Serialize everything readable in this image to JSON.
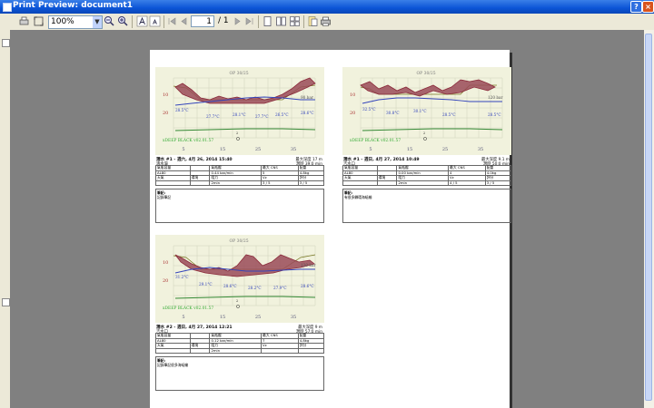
{
  "window": {
    "title": "Print Preview: document1"
  },
  "toolbar": {
    "zoom_value": "100%",
    "page_current": "1",
    "page_total": "/ 1"
  },
  "page_title": "OP 30/25",
  "plot_labels": {
    "depth10": "10",
    "depth20": "20",
    "x5": "5",
    "x15": "15",
    "x25": "25",
    "x35": "35",
    "device": "xDEEP BLACK v02.01.57"
  },
  "dives": [
    {
      "datetime": "潛水 #1 - 週六, 4月 26, 2014 15:40",
      "location": "清水灣",
      "max_depth": "最大深度 17 m",
      "duration": "潛時 39:0 min",
      "bar_label": "90 bar",
      "temps": [
        "28.5°C",
        "27.7°C",
        "28.1°C",
        "27.7°C",
        "26.5°C",
        "28.6°C"
      ],
      "table": [
        [
          "氣瓶容量",
          "",
          "氣瓶壓",
          "最大 CNS",
          "配重"
        ],
        [
          "AL80",
          "",
          "0.44 bar/min",
          "5",
          "4.8kg"
        ],
        [
          "天氣",
          "環境",
          "阻力",
          "Vz",
          "評分"
        ],
        [
          "",
          "",
          "2min",
          "3 / 5",
          "3 / 5"
        ]
      ],
      "notes": "筆記:\n記錄筆記"
    },
    {
      "datetime": "潛水 #1 - 週日, 4月 27, 2014 10:49",
      "location": "吉水口",
      "max_depth": "最大深度 9.1 m",
      "duration": "潛時 50:0 min",
      "bar_label": "120 bar",
      "temps": [
        "32.5°C",
        "30.8°C",
        "30.1°C",
        "28.5°C",
        "28.5°C"
      ],
      "table": [
        [
          "氣瓶容量",
          "",
          "氣瓶壓",
          "最大 CNS",
          "配重"
        ],
        [
          "AL80",
          "",
          "0.00 bar/min",
          "4",
          "4.0kg"
        ],
        [
          "天氣",
          "環境",
          "阻力",
          "Vz",
          "評分"
        ],
        [
          "",
          "",
          "2min",
          "4 / 5",
          "3 / 5"
        ]
      ],
      "notes": "筆記:\n有很多鱗環海蛞蝓"
    },
    {
      "datetime": "潛水 #2 - 週日, 4月 27, 2014 12:21",
      "location": "吉水口",
      "max_depth": "最大深度 9 m",
      "duration": "潛時 57:0 min",
      "bar_label": "120 bar",
      "temps": [
        "31.2°C",
        "29.1°C",
        "28.6°C",
        "28.2°C",
        "27.9°C",
        "28.6°C"
      ],
      "table": [
        [
          "氣瓶容量",
          "",
          "氣瓶壓",
          "最大 CNS",
          "配重"
        ],
        [
          "AL80",
          "",
          "0.12 bar/min",
          "7",
          "4.8kg"
        ],
        [
          "天氣",
          "環境",
          "阻力",
          "Vz",
          "評分"
        ],
        [
          "",
          "",
          "2min",
          "",
          ""
        ]
      ],
      "notes": "筆記:\n記錄筆記很多海蛞蝓"
    }
  ],
  "colors": {
    "profile": "#8a2a3a",
    "temp": "#3344bb",
    "gas": "#338833",
    "ceiling": "#777722"
  }
}
